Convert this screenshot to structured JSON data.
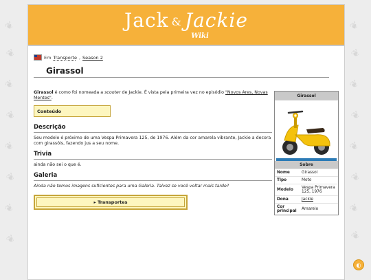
{
  "site": {
    "logo_main": "Jack",
    "logo_amp": "&",
    "logo_second": "Jackie",
    "logo_sub": "Wiki"
  },
  "breadcrumb": {
    "prefix": "Em",
    "category": "Transporte",
    "separator": ",",
    "season": "Season 2"
  },
  "page": {
    "title": "Girassol"
  },
  "intro": {
    "bold_name": "Girassol",
    "text_a": " é como foi nomeada a ",
    "scooter": "scooter",
    "text_b": " de Jackie. É vista pela primeira vez no episódio ",
    "episode_link": "\"Novos Ares, Novas Mentes\"",
    "text_end": "."
  },
  "toc": {
    "label": "Conteúdo"
  },
  "sections": {
    "description_title": "Descrição",
    "description_text": "Seu modelo é próximo de uma Vespa Primavera 125, de 1976. Além da cor amarela vibrante, Jackie a decora com girassóis, fazendo jus a seu nome.",
    "trivia_title": "Trivia",
    "trivia_text": "ainda não sei o que é.",
    "gallery_title": "Galeria",
    "gallery_text": "Ainda não temos imagens suficientes para uma Galeria. Talvez se você voltar mais tarde?"
  },
  "nav_box": {
    "label": "▸ Transportes"
  },
  "infobox": {
    "title": "Girassol",
    "section": "Sobre",
    "rows": [
      {
        "key": "Nome",
        "value": "Girassol",
        "link": false
      },
      {
        "key": "Tipo",
        "value": "Moto",
        "link": false
      },
      {
        "key": "Modelo",
        "value": "Vespa Primavera 125, 1976",
        "link": false
      },
      {
        "key": "Dona",
        "value": "Jackie",
        "link": true
      },
      {
        "key": "Cor principal",
        "value": "Amarelo",
        "link": false
      }
    ]
  },
  "colors": {
    "banner": "#f6b13a",
    "toc_bg": "#fdf6bf",
    "toc_border": "#c6a53a",
    "scooter": "#f4c20d"
  },
  "icons": {
    "fab": "theme-toggle-icon",
    "flag": "flag-icon"
  }
}
